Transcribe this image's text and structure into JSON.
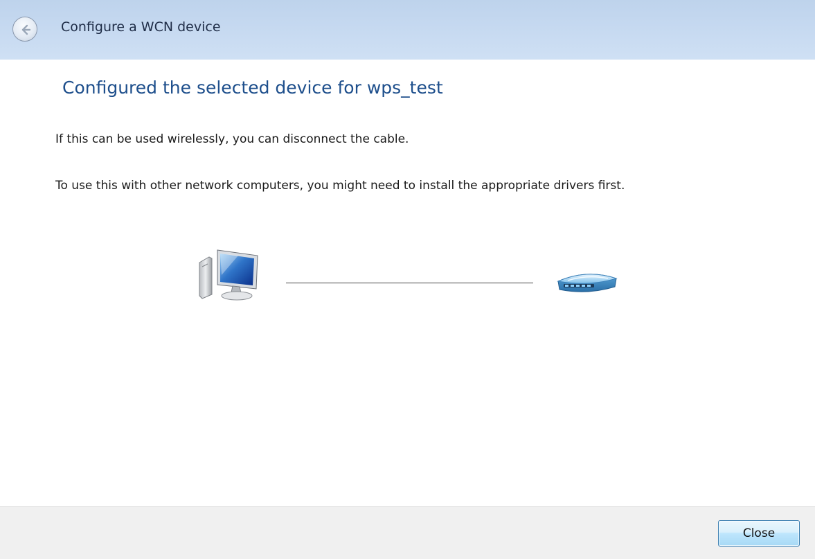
{
  "header": {
    "title": "Configure a WCN device",
    "back_icon": "back-arrow-icon"
  },
  "main": {
    "heading": "Configured the selected device for wps_test",
    "line1": "If this  can be used wirelessly, you can disconnect the cable.",
    "line2": "To use this  with other network computers, you might need to install the appropriate drivers first.",
    "diagram": {
      "left_icon": "computer-icon",
      "right_icon": "router-icon"
    }
  },
  "footer": {
    "close_label": "Close"
  },
  "colors": {
    "header_bg": "#c7daf1",
    "heading_text": "#1e4f8c",
    "footer_bg": "#f0f0f0",
    "button_border": "#3c7fb1"
  }
}
